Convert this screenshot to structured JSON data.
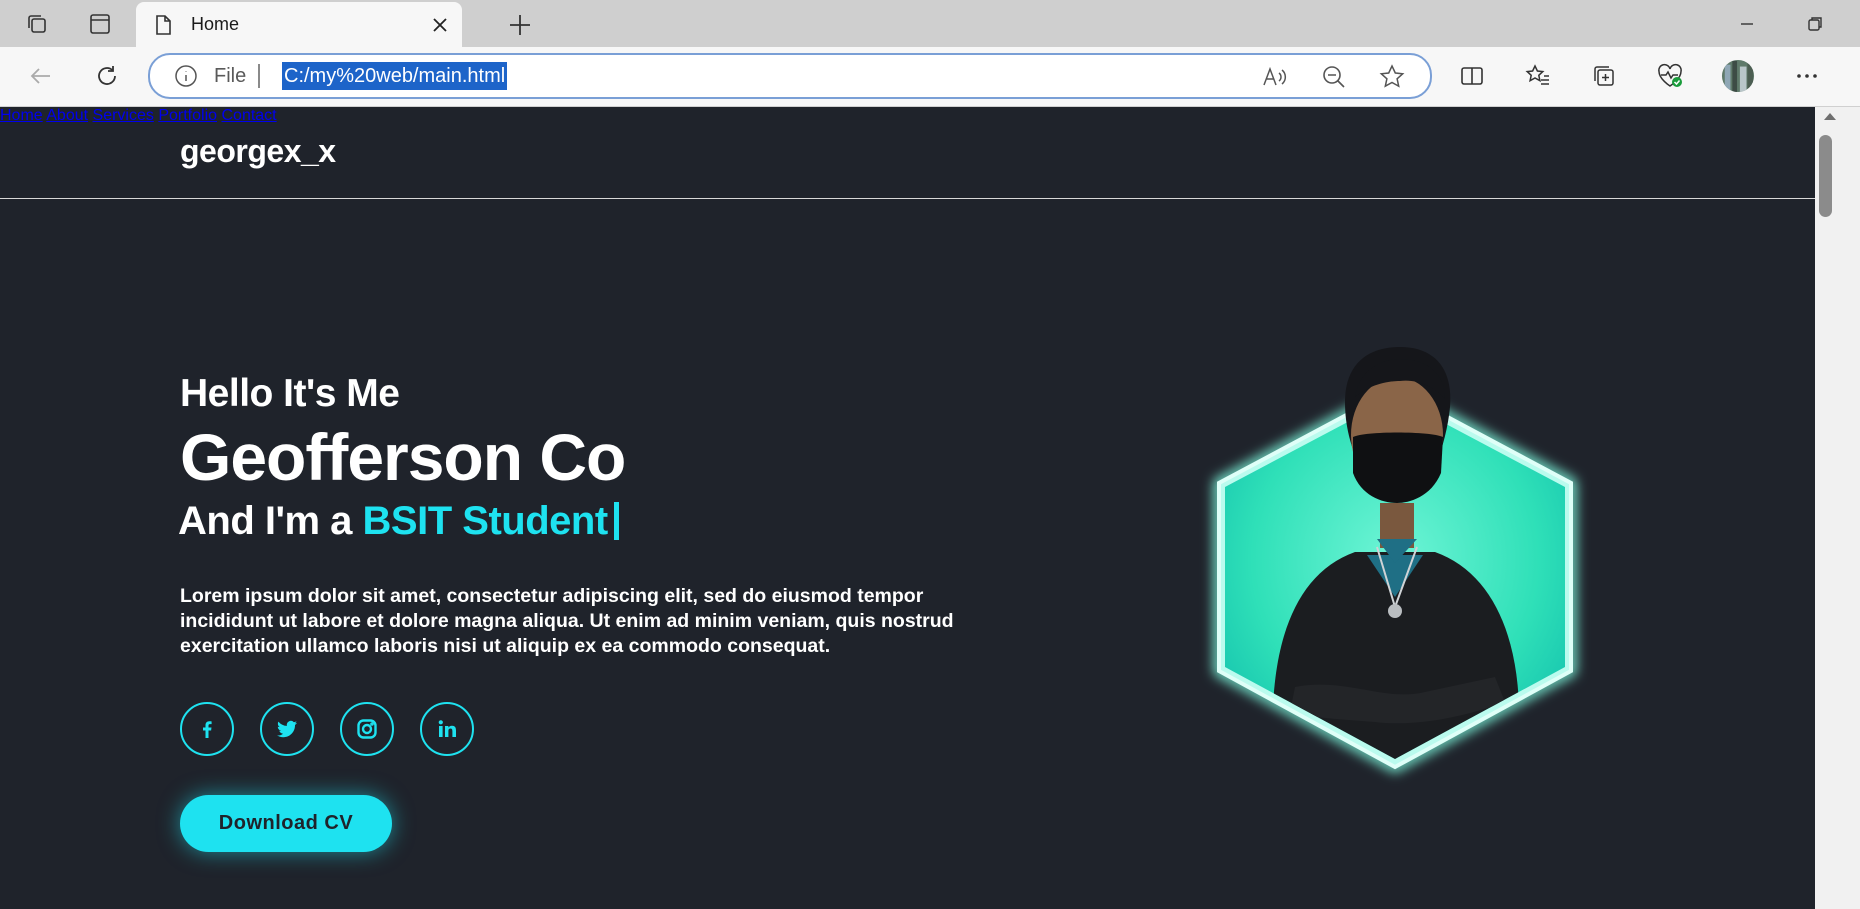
{
  "browser": {
    "tab_title": "Home",
    "address_scheme_label": "File",
    "address_url": "C:/my%20web/main.html"
  },
  "site": {
    "logo": "georgex_x",
    "nav": [
      {
        "label": "Home",
        "active": true
      },
      {
        "label": "About",
        "active": false
      },
      {
        "label": "Services",
        "active": false
      },
      {
        "label": "Portfolio",
        "active": false
      },
      {
        "label": "Contact",
        "active": false
      }
    ]
  },
  "hero": {
    "greeting": "Hello It's Me",
    "name": "Geofferson Co",
    "role_prefix": "And I'm a",
    "role_highlight": "BSIT Student",
    "description": "Lorem ipsum dolor sit amet, consectetur adipiscing elit, sed do eiusmod tempor incididunt ut labore et dolore magna aliqua. Ut enim ad minim veniam, quis nostrud exercitation ullamco laboris nisi ut aliquip ex ea commodo consequat.",
    "socials": [
      {
        "icon": "facebook-icon",
        "glyph": "f"
      },
      {
        "icon": "twitter-icon",
        "glyph": ""
      },
      {
        "icon": "instagram-icon",
        "glyph": ""
      },
      {
        "icon": "linkedin-icon",
        "glyph": "in"
      }
    ],
    "cv_button": "Download CV"
  },
  "colors": {
    "accent": "#1ee2f0",
    "page_background": "#1f232b",
    "hex_glow": "#3ef0c8"
  }
}
